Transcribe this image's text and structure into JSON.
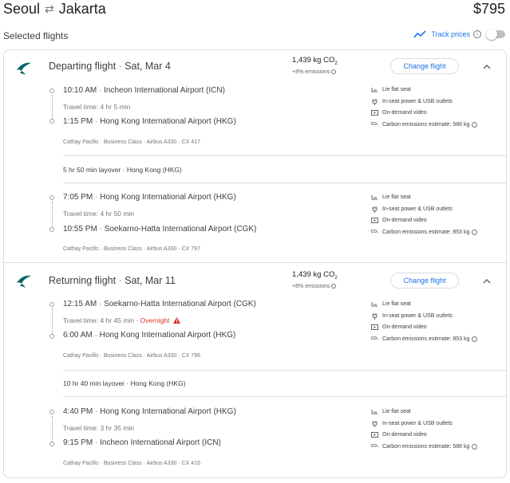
{
  "header": {
    "origin": "Seoul",
    "destination": "Jakarta",
    "price": "$795",
    "selected_label": "Selected flights",
    "track_label": "Track prices",
    "track_on": false
  },
  "colors": {
    "accent": "#1a73e8",
    "warning": "#d93025",
    "logo": "#006564"
  },
  "outbound": {
    "title": "Departing flight",
    "date": "Sat, Mar 4",
    "co2_value": "1,439 kg CO",
    "co2_sub": "2",
    "emissions_note": "+8% emissions",
    "change_label": "Change flight",
    "seg1": {
      "dep_time": "10:10 AM",
      "dep_airport": "Incheon International Airport (ICN)",
      "travel": "Travel time: 4 hr 5 min",
      "arr_time": "1:15 PM",
      "arr_airport": "Hong Kong International Airport (HKG)",
      "meta": "Cathay Pacific · Business Class · Airbus A330 · CX 417",
      "amenities": [
        "Lie flat seat",
        "In-seat power & USB outlets",
        "On-demand video",
        "Carbon emissions estimate: 586 kg"
      ]
    },
    "layover": "5 hr 50 min layover · Hong Kong (HKG)",
    "seg2": {
      "dep_time": "7:05 PM",
      "dep_airport": "Hong Kong International Airport (HKG)",
      "travel": "Travel time: 4 hr 50 min",
      "arr_time": "10:55 PM",
      "arr_airport": "Soekarno-Hatta International Airport (CGK)",
      "meta": "Cathay Pacific · Business Class · Airbus A330 · CX 797",
      "amenities": [
        "Lie flat seat",
        "In-seat power & USB outlets",
        "On-demand video",
        "Carbon emissions estimate: 853 kg"
      ]
    }
  },
  "return": {
    "title": "Returning flight",
    "date": "Sat, Mar 11",
    "co2_value": "1,439 kg CO",
    "co2_sub": "2",
    "emissions_note": "+8% emissions",
    "change_label": "Change flight",
    "seg1": {
      "dep_time": "12:15 AM",
      "dep_airport": "Soekarno-Hatta International Airport (CGK)",
      "travel": "Travel time: 4 hr 45 min",
      "overnight": "Overnight",
      "arr_time": "6:00 AM",
      "arr_airport": "Hong Kong International Airport (HKG)",
      "meta": "Cathay Pacific · Business Class · Airbus A330 · CX 796",
      "amenities": [
        "Lie flat seat",
        "In-seat power & USB outlets",
        "On-demand video",
        "Carbon emissions estimate: 853 kg"
      ]
    },
    "layover": "10 hr 40 min layover · Hong Kong (HKG)",
    "seg2": {
      "dep_time": "4:40 PM",
      "dep_airport": "Hong Kong International Airport (HKG)",
      "travel": "Travel time: 3 hr 35 min",
      "arr_time": "9:15 PM",
      "arr_airport": "Incheon International Airport (ICN)",
      "meta": "Cathay Pacific · Business Class · Airbus A330 · CX 416",
      "amenities": [
        "Lie flat seat",
        "In-seat power & USB outlets",
        "On-demand video",
        "Carbon emissions estimate: 586 kg"
      ]
    }
  },
  "icons": {
    "swap": "swap-arrows-icon",
    "trend": "trend-line-icon",
    "seat": "seat-icon",
    "power": "power-plug-icon",
    "video": "video-icon",
    "co2": "co2-icon",
    "warning": "warning-icon",
    "chevron": "chevron-up-icon",
    "info": "info-icon"
  }
}
